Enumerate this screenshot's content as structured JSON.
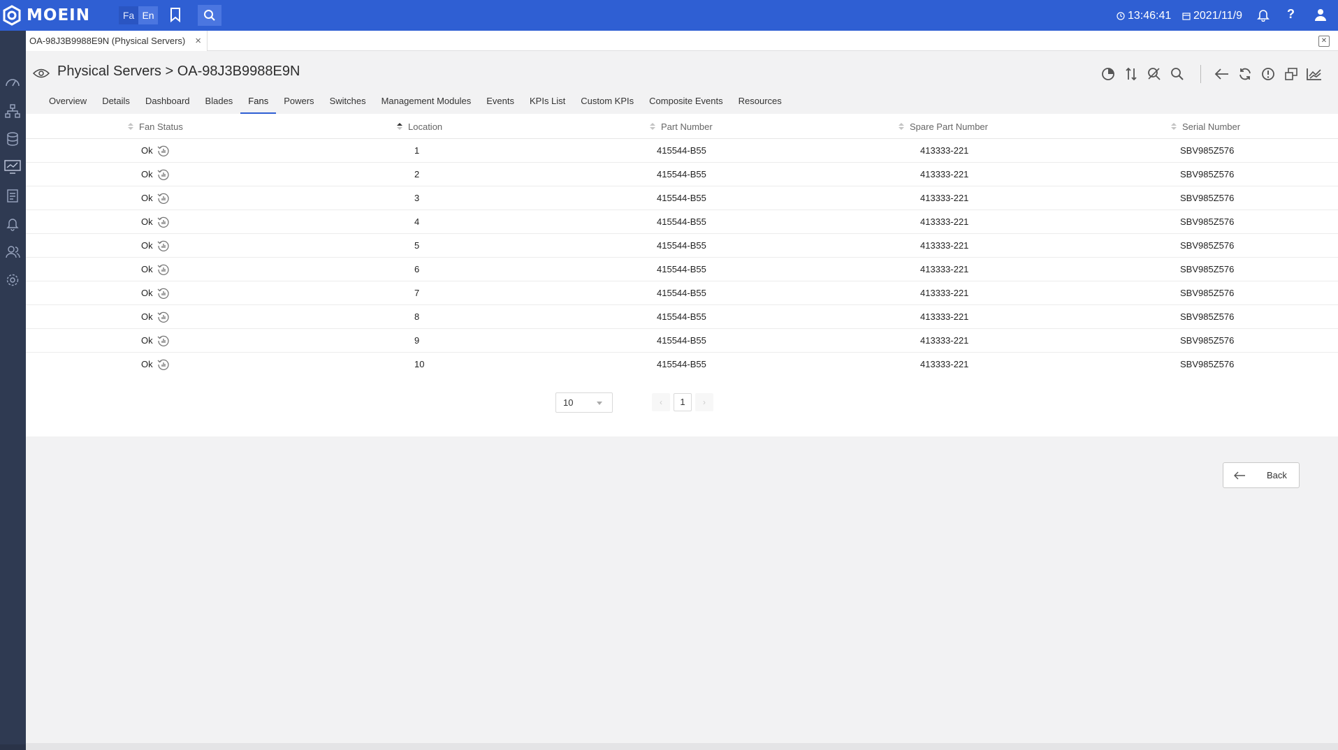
{
  "app": {
    "brand": "MOEIN",
    "lang_fa": "Fa",
    "lang_en": "En",
    "time": "13:46:41",
    "date": "2021/11/9",
    "help": "?"
  },
  "page_tab": {
    "label": "OA-98J3B9988E9N (Physical Servers)",
    "close": "×"
  },
  "header": {
    "title": "Physical Servers > OA-98J3B9988E9N"
  },
  "tabs": [
    "Overview",
    "Details",
    "Dashboard",
    "Blades",
    "Fans",
    "Powers",
    "Switches",
    "Management Modules",
    "Events",
    "KPIs List",
    "Custom KPIs",
    "Composite Events",
    "Resources"
  ],
  "active_tab": "Fans",
  "table": {
    "columns": [
      "Fan Status",
      "Location",
      "Part Number",
      "Spare Part Number",
      "Serial Number"
    ],
    "rows": [
      {
        "status": "Ok",
        "location": "1",
        "part": "415544-B55",
        "spare": "413333-221",
        "serial": "SBV985Z576"
      },
      {
        "status": "Ok",
        "location": "2",
        "part": "415544-B55",
        "spare": "413333-221",
        "serial": "SBV985Z576"
      },
      {
        "status": "Ok",
        "location": "3",
        "part": "415544-B55",
        "spare": "413333-221",
        "serial": "SBV985Z576"
      },
      {
        "status": "Ok",
        "location": "4",
        "part": "415544-B55",
        "spare": "413333-221",
        "serial": "SBV985Z576"
      },
      {
        "status": "Ok",
        "location": "5",
        "part": "415544-B55",
        "spare": "413333-221",
        "serial": "SBV985Z576"
      },
      {
        "status": "Ok",
        "location": "6",
        "part": "415544-B55",
        "spare": "413333-221",
        "serial": "SBV985Z576"
      },
      {
        "status": "Ok",
        "location": "7",
        "part": "415544-B55",
        "spare": "413333-221",
        "serial": "SBV985Z576"
      },
      {
        "status": "Ok",
        "location": "8",
        "part": "415544-B55",
        "spare": "413333-221",
        "serial": "SBV985Z576"
      },
      {
        "status": "Ok",
        "location": "9",
        "part": "415544-B55",
        "spare": "413333-221",
        "serial": "SBV985Z576"
      },
      {
        "status": "Ok",
        "location": "10",
        "part": "415544-B55",
        "spare": "413333-221",
        "serial": "SBV985Z576"
      }
    ]
  },
  "pagination": {
    "page_size": "10",
    "current_page": "1",
    "prev": "‹",
    "next": "›"
  },
  "back_label": "Back",
  "colors": {
    "topbar": "#2f5fd3",
    "sidebar": "#2f3a52",
    "accent": "#2f5fd3"
  }
}
